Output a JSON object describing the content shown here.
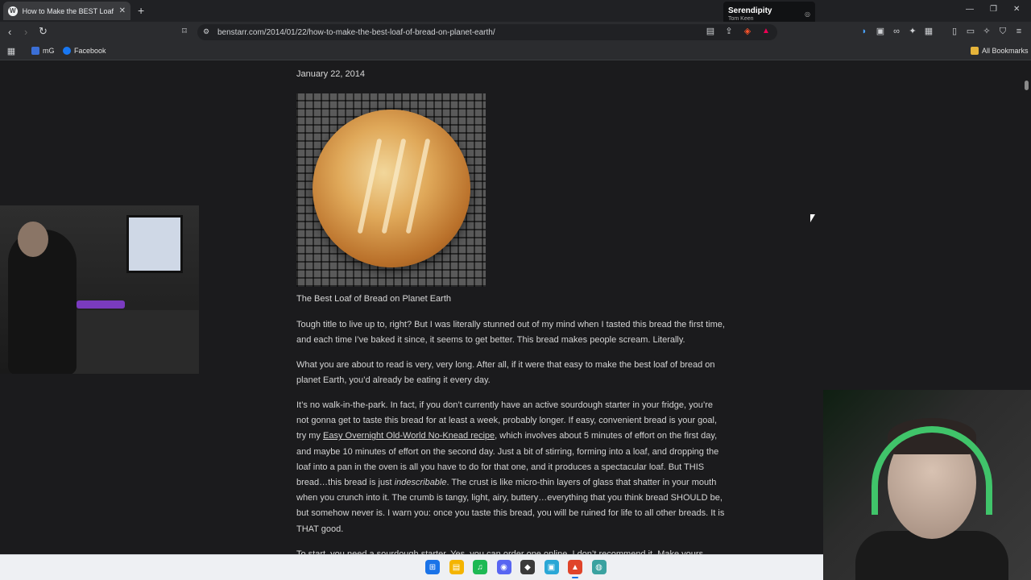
{
  "browser": {
    "tab_title": "How to Make the BEST Loaf of B",
    "url": "benstarr.com/2014/01/22/how-to-make-the-best-loaf-of-bread-on-planet-earth/",
    "bookmarks": [
      {
        "label": "mG",
        "color": "#3b6fd6"
      },
      {
        "label": "Facebook",
        "color": "#1877f2"
      }
    ],
    "all_bookmarks_label": "All Bookmarks"
  },
  "media": {
    "song": "Serendipity",
    "artist": "Tom Keen"
  },
  "article": {
    "date": "January 22, 2014",
    "image_caption": "The Best Loaf of Bread on Planet Earth",
    "p1": "Tough title to live up to, right?  But I was literally stunned out of my mind when I tasted this bread the first time, and each time I’ve baked it since, it seems to get better.  This bread makes people scream.  Literally.",
    "p2": "What you are about to read is very, very long.  After all, if it were that easy to make the best loaf of bread on planet Earth, you’d already be eating it every day.",
    "p3_a": "It’s no walk-in-the-park.  In fact, if you don’t currently have an active sourdough starter in your fridge, you’re not gonna get to taste this bread for at least a week, probably longer.  If easy, convenient bread is your goal, try my ",
    "p3_link": "Easy Overnight Old-World No-Knead recipe",
    "p3_b": ", which involves about 5 minutes of effort on the first day, and maybe 10 minutes of effort on the second day.  Just a bit of stirring, forming into a loaf, and dropping the loaf into a pan in the oven is all you have to do for that one, and it produces a spectacular loaf.  But THIS bread…this bread is just ",
    "p3_em": "indescribable",
    "p3_c": ".  The crust is like micro-thin layers of glass that shatter in your mouth when you crunch into it.  The crumb is tangy, light, airy, buttery…everything that you think bread SHOULD be, but somehow never is. I warn you: once you taste this bread, you will be ruined for life to all other breads.  It is THAT good.",
    "p4_partial": "To start, you need a sourdough starter. Yes, you can order one online. I don’t recommend it. Make yours"
  },
  "taskbar": {
    "apps": [
      {
        "name": "start",
        "color": "#1a73e8",
        "glyph": "⊞"
      },
      {
        "name": "file-explorer",
        "color": "#f4b400",
        "glyph": "▤"
      },
      {
        "name": "spotify",
        "color": "#1db954",
        "glyph": "♫"
      },
      {
        "name": "discord",
        "color": "#5865f2",
        "glyph": "◉"
      },
      {
        "name": "league",
        "color": "#3a3a3a",
        "glyph": "◆"
      },
      {
        "name": "store",
        "color": "#2aa7d6",
        "glyph": "▣"
      },
      {
        "name": "brave",
        "color": "#e0442a",
        "glyph": "▲"
      },
      {
        "name": "globe",
        "color": "#3aa2a0",
        "glyph": "◍"
      }
    ]
  }
}
